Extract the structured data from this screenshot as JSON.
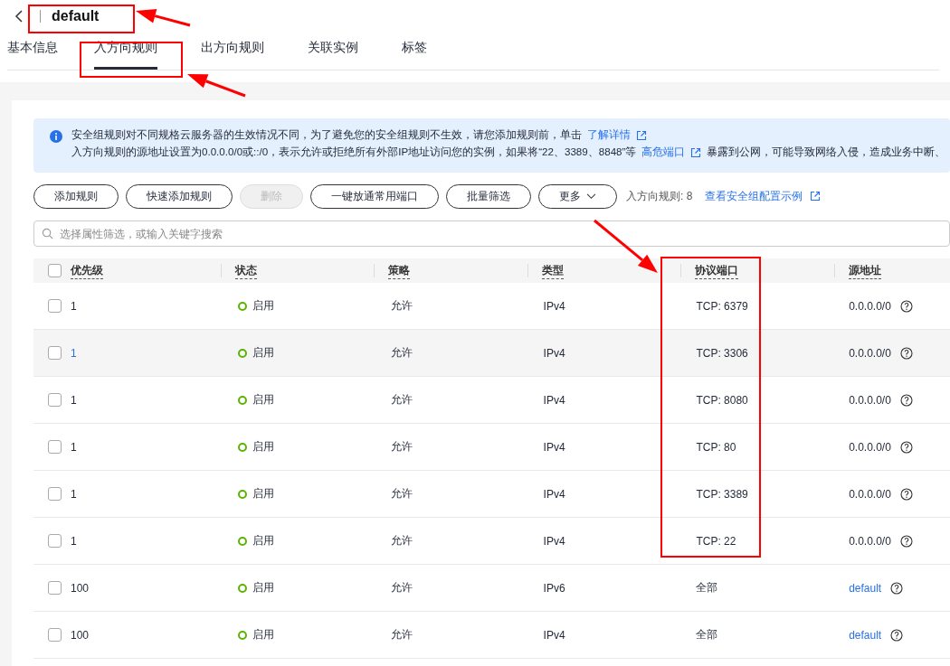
{
  "header": {
    "title": "default"
  },
  "tabs": [
    {
      "label": "基本信息",
      "selected": false
    },
    {
      "label": "入方向规则",
      "selected": true
    },
    {
      "label": "出方向规则",
      "selected": false
    },
    {
      "label": "关联实例",
      "selected": false
    },
    {
      "label": "标签",
      "selected": false
    }
  ],
  "notice": {
    "lines": [
      {
        "text": "安全组规则对不同规格云服务器的生效情况不同，为了避免您的安全组规则不生效，请您添加规则前，单击",
        "link": "了解详情"
      },
      {
        "text": "入方向规则的源地址设置为0.0.0.0/0或::/0，表示允许或拒绝所有外部IP地址访问您的实例，如果将“22、3389、8848”等",
        "link": "高危端口",
        "after": "暴露到公网，可能导致网络入侵，造成业务中断、"
      }
    ]
  },
  "toolbar": {
    "buttons": [
      {
        "label": "添加规则",
        "disabled": false,
        "kind": "plain"
      },
      {
        "label": "快速添加规则",
        "disabled": false,
        "kind": "plain"
      },
      {
        "label": "删除",
        "disabled": true,
        "kind": "plain"
      },
      {
        "label": "一键放通常用端口",
        "disabled": false,
        "kind": "plain"
      },
      {
        "label": "批量筛选",
        "disabled": false,
        "kind": "plain"
      },
      {
        "label": "更多",
        "disabled": false,
        "kind": "dropdown"
      }
    ],
    "count": "入方向规则: 8",
    "link": "查看安全组配置示例"
  },
  "search": {
    "placeholder": "选择属性筛选，或输入关键字搜索"
  },
  "table": {
    "all_checked": false,
    "columns": [
      "优先级",
      "状态",
      "策略",
      "类型",
      "协议端口",
      "源地址"
    ],
    "rows": [
      {
        "priority": "1",
        "status": "启用",
        "policy": "允许",
        "type": "IPv4",
        "port": "TCP: 6379",
        "source": "0.0.0.0/0",
        "kind": "cidr",
        "checked": false,
        "hovered": false
      },
      {
        "priority": "1",
        "status": "启用",
        "policy": "允许",
        "type": "IPv4",
        "port": "TCP: 3306",
        "source": "0.0.0.0/0",
        "kind": "cidr",
        "checked": false,
        "hovered": true
      },
      {
        "priority": "1",
        "status": "启用",
        "policy": "允许",
        "type": "IPv4",
        "port": "TCP: 8080",
        "source": "0.0.0.0/0",
        "kind": "cidr",
        "checked": false,
        "hovered": false
      },
      {
        "priority": "1",
        "status": "启用",
        "policy": "允许",
        "type": "IPv4",
        "port": "TCP: 80",
        "source": "0.0.0.0/0",
        "kind": "cidr",
        "checked": false,
        "hovered": false
      },
      {
        "priority": "1",
        "status": "启用",
        "policy": "允许",
        "type": "IPv4",
        "port": "TCP: 3389",
        "source": "0.0.0.0/0",
        "kind": "cidr",
        "checked": false,
        "hovered": false
      },
      {
        "priority": "1",
        "status": "启用",
        "policy": "允许",
        "type": "IPv4",
        "port": "TCP: 22",
        "source": "0.0.0.0/0",
        "kind": "cidr",
        "checked": false,
        "hovered": false
      },
      {
        "priority": "100",
        "status": "启用",
        "policy": "允许",
        "type": "IPv6",
        "port": "全部",
        "source": "default",
        "kind": "group",
        "checked": false,
        "hovered": false
      },
      {
        "priority": "100",
        "status": "启用",
        "policy": "允许",
        "type": "IPv4",
        "port": "全部",
        "source": "default",
        "kind": "group",
        "checked": false,
        "hovered": false
      }
    ]
  }
}
